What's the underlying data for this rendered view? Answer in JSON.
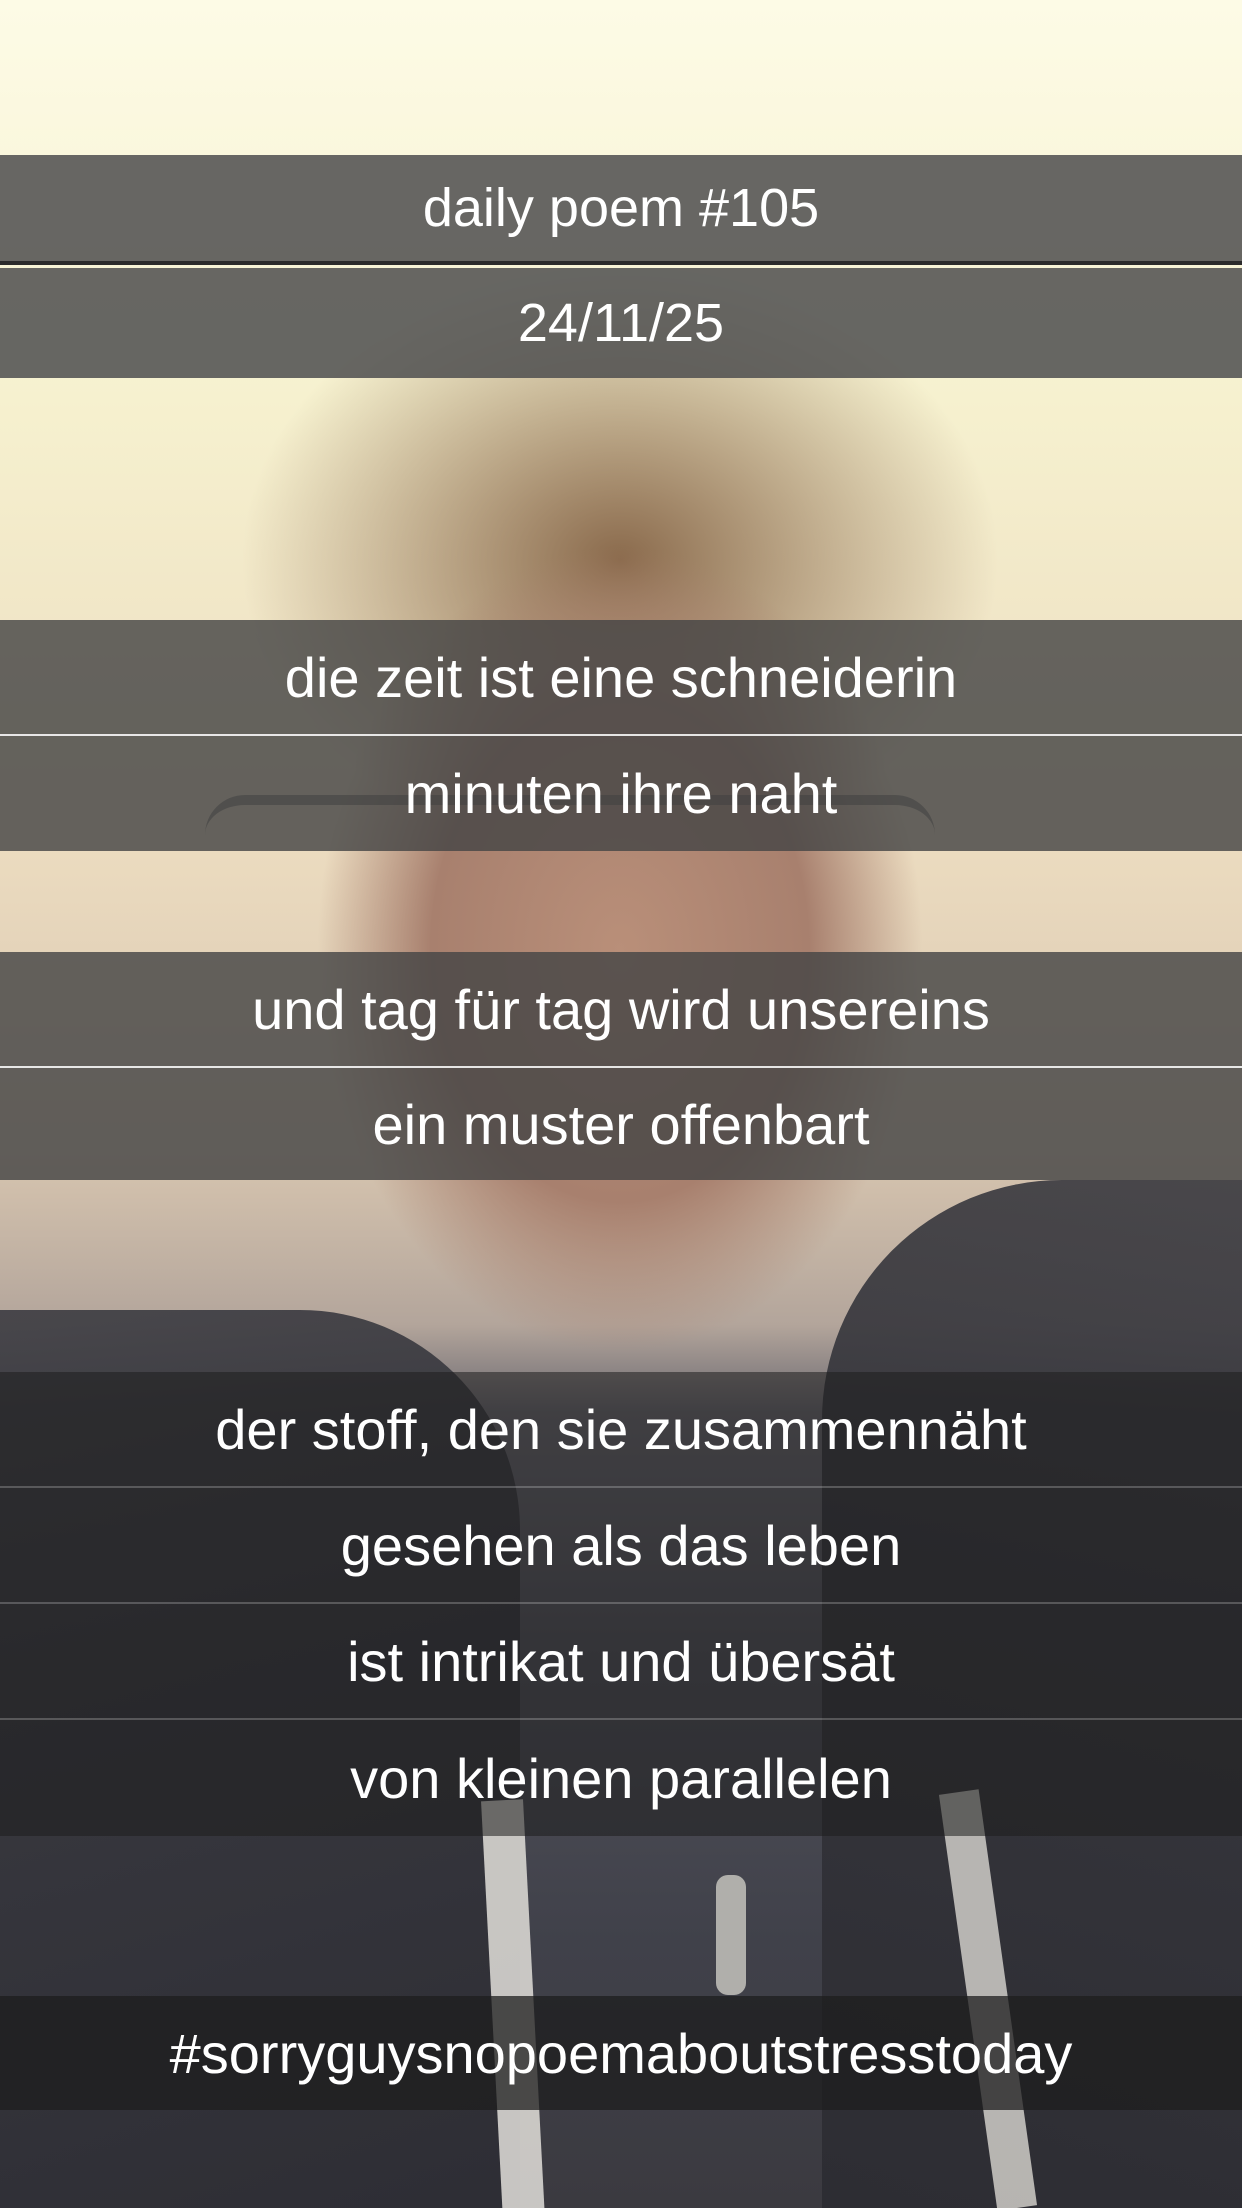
{
  "poem": {
    "title": "daily poem #105",
    "date": "24/11/25",
    "stanzas": [
      {
        "lines": [
          "die zeit ist eine schneiderin",
          "minuten ihre naht"
        ]
      },
      {
        "lines": [
          "und tag für tag wird unsereins",
          "ein muster offenbart"
        ]
      },
      {
        "lines": [
          "der stoff, den sie zusammennäht",
          "gesehen als das leben",
          "ist intrikat und übersät",
          "von kleinen parallelen"
        ]
      }
    ],
    "hashtag": "#sorryguysnopoemaboutstresstoday"
  }
}
